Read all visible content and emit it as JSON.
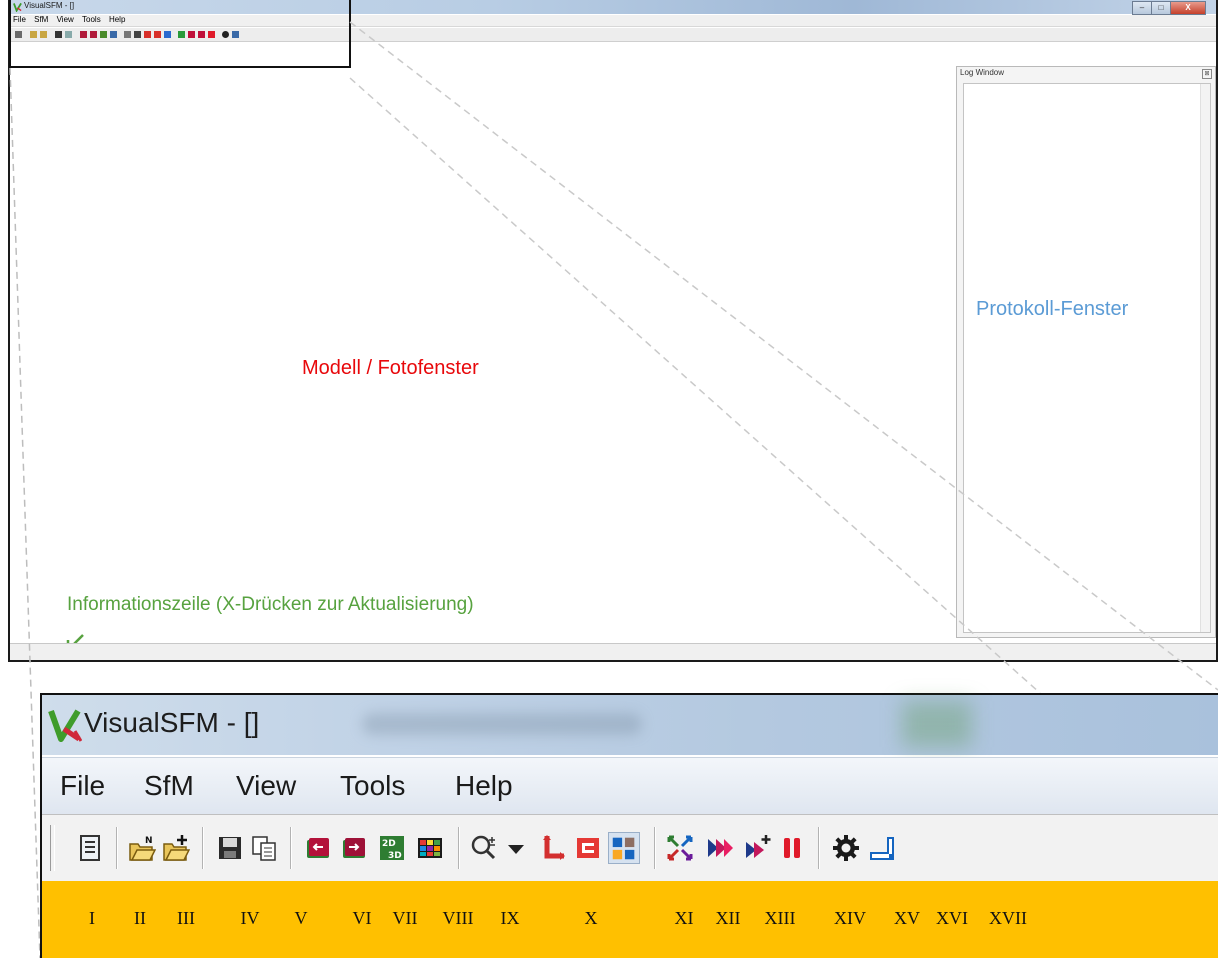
{
  "window": {
    "title": "VisualSFM - []",
    "menu": [
      "File",
      "SfM",
      "View",
      "Tools",
      "Help"
    ],
    "caption_buttons": [
      "–",
      "□",
      "X"
    ]
  },
  "annotations": {
    "model_window": "Modell / Fotofenster",
    "log_window_label": "Protokoll-Fenster",
    "info_line": "Informationszeile (X-Drücken zur Aktualisierung)"
  },
  "log_window": {
    "title": "Log Window",
    "close_glyph": "⊠"
  },
  "zoom": {
    "title": "VisualSFM - []",
    "menu": [
      "File",
      "SfM",
      "View",
      "Tools",
      "Help"
    ]
  },
  "toolbar_icons": [
    "log-window-toggle-icon",
    "open-multiple-images-icon",
    "add-images-icon",
    "save-nvm-icon",
    "copy-icon",
    "previous-image-icon",
    "next-image-icon",
    "switch-2d-3d-icon",
    "show-thumbnails-icon",
    "zoom-icon",
    "dropdown-arrow-icon",
    "show-features-icon",
    "show-matches-icon",
    "show-match-matrix-icon",
    "compute-missing-matches-icon",
    "compute-3d-reconstruction-icon",
    "add-images-to-model-icon",
    "pause-icon",
    "settings-gear-icon",
    "dense-reconstruction-icon"
  ],
  "roman_numerals": [
    "I",
    "II",
    "III",
    "IV",
    "V",
    "VI",
    "VII",
    "VIII",
    "IX",
    "X",
    "XI",
    "XII",
    "XIII",
    "XIV",
    "XV",
    "XVI",
    "XVII"
  ],
  "colors": {
    "model_label": "#e8080b",
    "log_label": "#5b9bd5",
    "info_label": "#57a23f",
    "numeral_bar": "#ffc000"
  }
}
